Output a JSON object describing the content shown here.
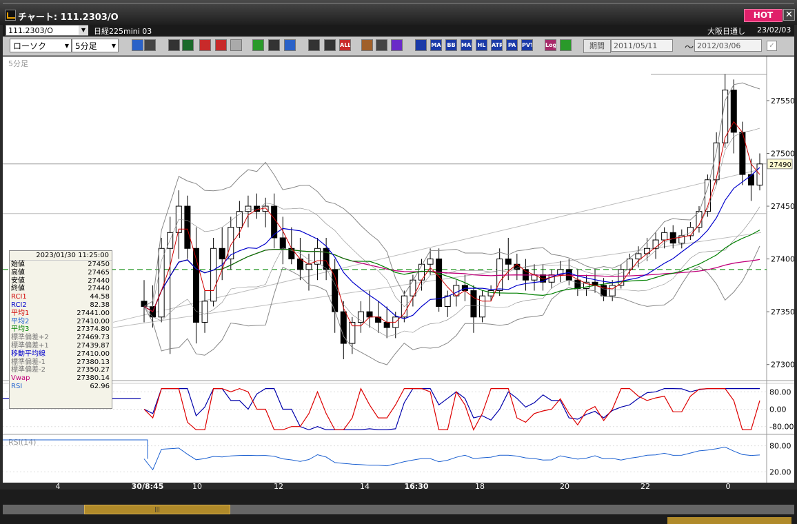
{
  "window": {
    "title": "チャート: 111.2303/O",
    "hot_label": "HOT",
    "close_label": "✕"
  },
  "header": {
    "symbol_code": "111.2303/O",
    "symbol_name": "日経225mini 03",
    "session": "大阪日通し",
    "date": "23/02/03"
  },
  "toolbar": {
    "chart_type": "ローソク",
    "interval": "5分足",
    "icons": [
      {
        "name": "zoom-icon",
        "label": "",
        "color": "#2a62c8"
      },
      {
        "name": "crosshair-icon",
        "label": "",
        "color": "#444"
      },
      {
        "name": "scroll-icon",
        "label": "",
        "color": "#333"
      },
      {
        "name": "zoom-out-icon",
        "label": "",
        "color": "#1a6a2a"
      },
      {
        "name": "bar-chart-icon",
        "label": "",
        "color": "#c82a2a"
      },
      {
        "name": "compare-icon",
        "label": "",
        "color": "#c82a2a"
      },
      {
        "name": "disabled-icon",
        "label": "",
        "color": "#aaa"
      },
      {
        "name": "pen-icon",
        "label": "",
        "color": "#2a9a2a"
      },
      {
        "name": "cursor-icon",
        "label": "",
        "color": "#333"
      },
      {
        "name": "undo-icon",
        "label": "",
        "color": "#2a62c8"
      },
      {
        "name": "candle-icon",
        "label": "",
        "color": "#333"
      },
      {
        "name": "candle2-icon",
        "label": "",
        "color": "#333"
      },
      {
        "name": "all-icon",
        "label": "ALL",
        "color": "#c82a2a"
      },
      {
        "name": "settings-icon",
        "label": "",
        "color": "#a0602a"
      },
      {
        "name": "wrench-icon",
        "label": "",
        "color": "#444"
      },
      {
        "name": "color-icon",
        "label": "",
        "color": "#6a2ac8"
      },
      {
        "name": "candle-chart-icon",
        "label": "",
        "color": "#1a3aa8"
      },
      {
        "name": "ma-icon",
        "label": "MA",
        "color": "#1a3aa8"
      },
      {
        "name": "bb-icon",
        "label": "BB",
        "color": "#1a3aa8"
      },
      {
        "name": "mae-icon",
        "label": "MAE",
        "color": "#1a3aa8"
      },
      {
        "name": "hl-icon",
        "label": "HL",
        "color": "#1a3aa8"
      },
      {
        "name": "atr-icon",
        "label": "ATR",
        "color": "#1a3aa8"
      },
      {
        "name": "para-icon",
        "label": "PA",
        "color": "#1a3aa8"
      },
      {
        "name": "pvt-icon",
        "label": "PVT",
        "color": "#1a3aa8"
      },
      {
        "name": "log-icon",
        "label": "Log",
        "color": "#a82a6a"
      },
      {
        "name": "export-icon",
        "label": "",
        "color": "#2a9a2a"
      }
    ],
    "period_label": "期間",
    "date_from": "2011/05/11",
    "date_to": "2012/03/06",
    "range_sep": "〜"
  },
  "chart": {
    "interval_caption": "5分足",
    "rsi_caption": "RSI(14)",
    "last_price_tag": "27490",
    "price_ticks": [
      "27550",
      "27500",
      "27450",
      "27400",
      "27350",
      "27300"
    ],
    "rci_ticks": [
      "80.00",
      "0.00",
      "-80.00"
    ],
    "rsi_ticks": [
      "80.00",
      "20.00"
    ],
    "x_ticks": [
      "4",
      "30/8:45",
      "10",
      "12",
      "14",
      "16:30",
      "18",
      "20",
      "22",
      "0"
    ],
    "colors": {
      "sma1": "#d00000",
      "sma2": "#0000cc",
      "sma3": "#008000",
      "bb": "#888888",
      "vwap": "#c0007a",
      "rci1": "#dd0000",
      "rci2": "#0000aa",
      "rsi": "#1a5fd0"
    }
  },
  "chart_data": {
    "type": "candlestick",
    "y_range": [
      27290,
      27580
    ],
    "candles": [
      [
        27360,
        27380,
        27340,
        27355
      ],
      [
        27355,
        27375,
        27335,
        27345
      ],
      [
        27345,
        27420,
        27340,
        27410
      ],
      [
        27410,
        27440,
        27310,
        27425
      ],
      [
        27425,
        27465,
        27400,
        27450
      ],
      [
        27450,
        27460,
        27400,
        27410
      ],
      [
        27410,
        27430,
        27320,
        27340
      ],
      [
        27340,
        27370,
        27330,
        27360
      ],
      [
        27360,
        27420,
        27355,
        27410
      ],
      [
        27410,
        27430,
        27380,
        27400
      ],
      [
        27400,
        27440,
        27390,
        27430
      ],
      [
        27430,
        27455,
        27420,
        27445
      ],
      [
        27445,
        27460,
        27430,
        27450
      ],
      [
        27450,
        27462,
        27438,
        27445
      ],
      [
        27445,
        27458,
        27430,
        27450
      ],
      [
        27450,
        27462,
        27410,
        27420
      ],
      [
        27420,
        27440,
        27395,
        27410
      ],
      [
        27410,
        27430,
        27395,
        27400
      ],
      [
        27400,
        27420,
        27380,
        27390
      ],
      [
        27390,
        27405,
        27370,
        27395
      ],
      [
        27395,
        27420,
        27380,
        27410
      ],
      [
        27410,
        27420,
        27380,
        27390
      ],
      [
        27390,
        27400,
        27330,
        27350
      ],
      [
        27350,
        27360,
        27305,
        27320
      ],
      [
        27320,
        27345,
        27310,
        27340
      ],
      [
        27340,
        27360,
        27330,
        27350
      ],
      [
        27350,
        27370,
        27335,
        27345
      ],
      [
        27345,
        27360,
        27330,
        27340
      ],
      [
        27340,
        27355,
        27325,
        27335
      ],
      [
        27335,
        27350,
        27325,
        27345
      ],
      [
        27345,
        27370,
        27340,
        27365
      ],
      [
        27365,
        27385,
        27355,
        27380
      ],
      [
        27380,
        27400,
        27370,
        27395
      ],
      [
        27395,
        27410,
        27385,
        27400
      ],
      [
        27400,
        27410,
        27350,
        27355
      ],
      [
        27355,
        27370,
        27345,
        27365
      ],
      [
        27365,
        27380,
        27355,
        27375
      ],
      [
        27375,
        27385,
        27360,
        27370
      ],
      [
        27370,
        27375,
        27330,
        27345
      ],
      [
        27345,
        27370,
        27340,
        27365
      ],
      [
        27365,
        27375,
        27360,
        27370
      ],
      [
        27370,
        27410,
        27365,
        27400
      ],
      [
        27400,
        27420,
        27380,
        27395
      ],
      [
        27395,
        27405,
        27380,
        27390
      ],
      [
        27390,
        27400,
        27370,
        27380
      ],
      [
        27380,
        27395,
        27370,
        27385
      ],
      [
        27385,
        27395,
        27370,
        27378
      ],
      [
        27378,
        27390,
        27372,
        27385
      ],
      [
        27385,
        27398,
        27378,
        27390
      ],
      [
        27390,
        27400,
        27375,
        27380
      ],
      [
        27380,
        27390,
        27365,
        27372
      ],
      [
        27372,
        27385,
        27365,
        27378
      ],
      [
        27378,
        27390,
        27368,
        27375
      ],
      [
        27375,
        27382,
        27360,
        27365
      ],
      [
        27365,
        27380,
        27360,
        27375
      ],
      [
        27375,
        27395,
        27372,
        27390
      ],
      [
        27390,
        27405,
        27385,
        27400
      ],
      [
        27400,
        27412,
        27392,
        27405
      ],
      [
        27405,
        27420,
        27398,
        27410
      ],
      [
        27410,
        27425,
        27400,
        27418
      ],
      [
        27418,
        27430,
        27410,
        27425
      ],
      [
        27425,
        27432,
        27410,
        27415
      ],
      [
        27415,
        27428,
        27410,
        27422
      ],
      [
        27422,
        27435,
        27418,
        27430
      ],
      [
        27430,
        27450,
        27425,
        27445
      ],
      [
        27445,
        27480,
        27440,
        27475
      ],
      [
        27475,
        27520,
        27470,
        27510
      ],
      [
        27510,
        27575,
        27505,
        27560
      ],
      [
        27560,
        27570,
        27500,
        27520
      ],
      [
        27520,
        27530,
        27470,
        27480
      ],
      [
        27480,
        27495,
        27455,
        27470
      ],
      [
        27470,
        27500,
        27465,
        27490
      ]
    ],
    "legend": {
      "datetime": "2023/01/30  11:25:00",
      "rows": [
        {
          "label": "始値",
          "value": "27450",
          "color": "#000"
        },
        {
          "label": "高値",
          "value": "27465",
          "color": "#000"
        },
        {
          "label": "安値",
          "value": "27440",
          "color": "#000"
        },
        {
          "label": "終値",
          "value": "27440",
          "color": "#000"
        },
        {
          "label": "RCI1",
          "value": "44.58",
          "color": "#d00000"
        },
        {
          "label": "RCI2",
          "value": "82.38",
          "color": "#0000cc"
        },
        {
          "label": "平均1",
          "value": "27441.00",
          "color": "#d00000"
        },
        {
          "label": "平均2",
          "value": "27410.00",
          "color": "#1a5fd0"
        },
        {
          "label": "平均3",
          "value": "27374.80",
          "color": "#008000"
        },
        {
          "label": "標準偏差+2",
          "value": "27469.73",
          "color": "#777"
        },
        {
          "label": "標準偏差+1",
          "value": "27439.87",
          "color": "#777"
        },
        {
          "label": "移動平均線",
          "value": "27410.00",
          "color": "#0000cc"
        },
        {
          "label": "標準偏差-1",
          "value": "27380.13",
          "color": "#777"
        },
        {
          "label": "標準偏差-2",
          "value": "27350.27",
          "color": "#777"
        },
        {
          "label": "Vwap",
          "value": "27380.14",
          "color": "#c0007a"
        },
        {
          "label": "RSI",
          "value": "62.96",
          "color": "#1a5fd0"
        }
      ]
    }
  }
}
